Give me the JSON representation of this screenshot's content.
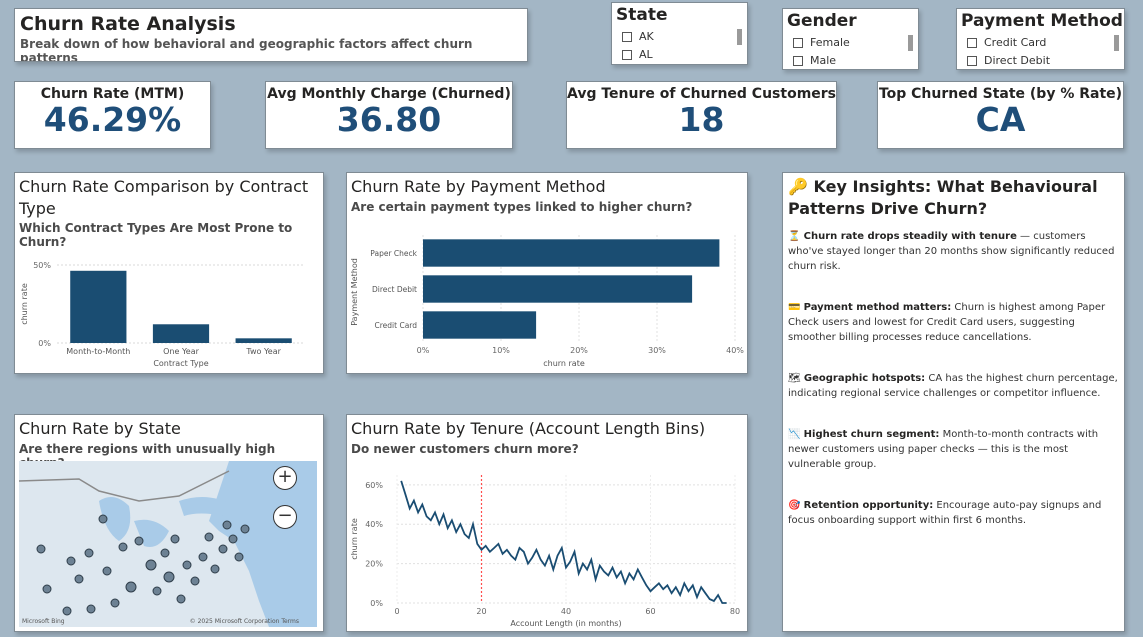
{
  "header": {
    "title": "Churn Rate Analysis",
    "subtitle": "Break down of how behavioral and geographic factors affect churn patterns"
  },
  "slicers": {
    "state": {
      "title": "State",
      "options": [
        "AK",
        "AL"
      ]
    },
    "gender": {
      "title": "Gender",
      "options": [
        "Female",
        "Male"
      ]
    },
    "payment": {
      "title": "Payment Method",
      "options": [
        "Credit Card",
        "Direct Debit"
      ]
    }
  },
  "kpis": [
    {
      "label": "Churn Rate (MTM)",
      "value": "46.29%"
    },
    {
      "label": "Avg Monthly Charge (Churned)",
      "value": "36.80"
    },
    {
      "label": "Avg Tenure of Churned Customers",
      "value": "18"
    },
    {
      "label": "Top Churned State (by % Rate)",
      "value": "CA"
    }
  ],
  "contract_chart": {
    "title": "Churn Rate Comparison by Contract Type",
    "subtitle": "Which Contract Types Are Most Prone to Churn?"
  },
  "payment_chart": {
    "title": "Churn Rate by Payment Method",
    "subtitle": "Are certain payment types linked to higher churn?"
  },
  "state_map": {
    "title": "Churn Rate by State",
    "subtitle": "Are there regions with unusually high churn?",
    "zoom_in": "+",
    "zoom_out": "−",
    "credit_left": "Microsoft Bing",
    "credit_right": "© 2025 Microsoft Corporation   Terms"
  },
  "tenure_chart": {
    "title": "Churn Rate by Tenure (Account Length Bins)",
    "subtitle": "Do newer customers churn more?"
  },
  "insights": {
    "icon": "🔑",
    "title": "Key Insights: What Behavioural Patterns Drive Churn?",
    "items": [
      {
        "icon": "⏳",
        "head": "Churn rate drops steadily with tenure",
        "text": " — customers who've stayed longer than 20 months show significantly reduced churn risk."
      },
      {
        "icon": "💳",
        "head": "Payment method matters:",
        "text": " Churn is highest among Paper Check users and lowest for Credit Card users, suggesting smoother billing processes reduce cancellations."
      },
      {
        "icon": "🗺",
        "head": "Geographic hotspots:",
        "text": " CA has the highest churn percentage, indicating regional service challenges or competitor influence."
      },
      {
        "icon": "📉",
        "head": "Highest churn segment:",
        "text": " Month-to-month contracts with newer customers using paper checks — this is the most vulnerable group."
      },
      {
        "icon": "🎯",
        "head": "Retention opportunity:",
        "text": " Encourage auto-pay signups and focus onboarding support within first 6 months."
      }
    ]
  },
  "colors": {
    "bar": "#1a4d72",
    "background": "#a3b6c5",
    "kpi": "#1f4e79",
    "marker": "#ff4d4d"
  },
  "chart_data": [
    {
      "type": "bar",
      "orientation": "vertical",
      "categories": [
        "Month-to-Month",
        "One Year",
        "Two Year"
      ],
      "values": [
        0.4629,
        0.12,
        0.03
      ],
      "xlabel": "Contract Type",
      "ylabel": "churn rate",
      "ylim": [
        0,
        0.5
      ],
      "yticks": [
        "0%",
        "50%"
      ]
    },
    {
      "type": "bar",
      "orientation": "horizontal",
      "categories": [
        "Paper Check",
        "Direct Debit",
        "Credit Card"
      ],
      "values": [
        0.38,
        0.345,
        0.145
      ],
      "xlabel": "churn rate",
      "ylabel": "Payment Method",
      "xlim": [
        0,
        0.4
      ],
      "xticks": [
        "0%",
        "10%",
        "20%",
        "30%",
        "40%"
      ]
    },
    {
      "type": "line",
      "x": [
        1,
        2,
        3,
        4,
        5,
        6,
        7,
        8,
        9,
        10,
        11,
        12,
        13,
        14,
        15,
        16,
        17,
        18,
        19,
        20,
        21,
        22,
        23,
        24,
        25,
        26,
        27,
        28,
        29,
        30,
        31,
        32,
        33,
        34,
        35,
        36,
        37,
        38,
        39,
        40,
        41,
        42,
        43,
        44,
        45,
        46,
        47,
        48,
        49,
        50,
        51,
        52,
        53,
        54,
        55,
        56,
        57,
        58,
        59,
        60,
        61,
        62,
        63,
        64,
        65,
        66,
        67,
        68,
        69,
        70,
        71,
        72,
        73,
        74,
        75,
        76,
        77,
        78
      ],
      "values": [
        0.62,
        0.55,
        0.48,
        0.52,
        0.46,
        0.5,
        0.44,
        0.42,
        0.46,
        0.4,
        0.45,
        0.38,
        0.42,
        0.36,
        0.4,
        0.35,
        0.33,
        0.4,
        0.3,
        0.27,
        0.29,
        0.26,
        0.28,
        0.3,
        0.25,
        0.27,
        0.24,
        0.22,
        0.28,
        0.26,
        0.2,
        0.23,
        0.27,
        0.22,
        0.19,
        0.24,
        0.17,
        0.24,
        0.28,
        0.18,
        0.21,
        0.26,
        0.15,
        0.2,
        0.17,
        0.22,
        0.12,
        0.19,
        0.16,
        0.14,
        0.18,
        0.13,
        0.16,
        0.1,
        0.15,
        0.12,
        0.17,
        0.13,
        0.09,
        0.06,
        0.08,
        0.1,
        0.07,
        0.09,
        0.05,
        0.08,
        0.04,
        0.1,
        0.06,
        0.09,
        0.03,
        0.08,
        0.05,
        0.02,
        0.01,
        0.04,
        0.0,
        0.0
      ],
      "xlabel": "Account Length (in months)",
      "ylabel": "churn rate",
      "xlim": [
        0,
        80
      ],
      "ylim": [
        0,
        0.65
      ],
      "xticks": [
        "0",
        "20",
        "40",
        "60",
        "80"
      ],
      "yticks": [
        "0%",
        "20%",
        "40%",
        "60%"
      ],
      "reference_line_x": 20
    }
  ]
}
